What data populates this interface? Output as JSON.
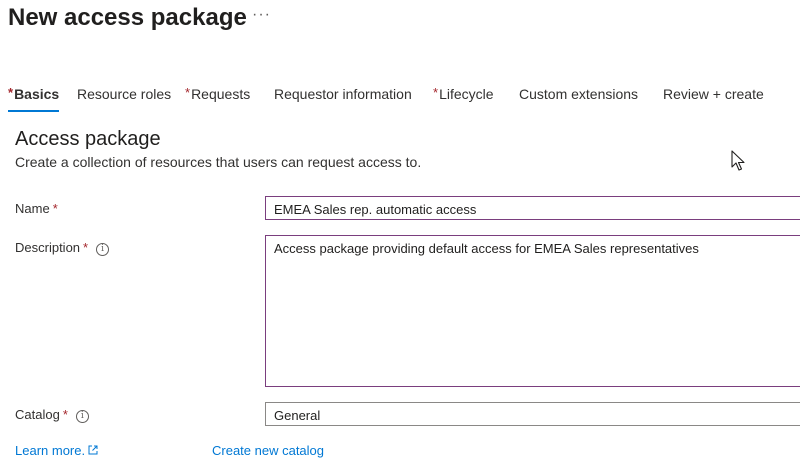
{
  "header": {
    "title": "New access package",
    "more_label": "···"
  },
  "tabs": [
    {
      "label": "Basics",
      "required": true,
      "active": true
    },
    {
      "label": "Resource roles",
      "required": false
    },
    {
      "label": "Requests",
      "required": true
    },
    {
      "label": "Requestor information",
      "required": false
    },
    {
      "label": "Lifecycle",
      "required": true
    },
    {
      "label": "Custom extensions",
      "required": false
    },
    {
      "label": "Review + create",
      "required": false
    }
  ],
  "required_marker": "*",
  "section": {
    "title": "Access package",
    "description": "Create a collection of resources that users can request access to."
  },
  "form": {
    "name": {
      "label": "Name",
      "value": "EMEA Sales rep. automatic access"
    },
    "description": {
      "label": "Description",
      "value": "Access package providing default access for EMEA Sales representatives"
    },
    "catalog": {
      "label": "Catalog",
      "value": "General"
    }
  },
  "links": {
    "learn_more": "Learn more.",
    "create_catalog": "Create new catalog"
  },
  "colors": {
    "accent": "#0078d4",
    "required": "#a4262c",
    "focus_border": "#7a3e7e"
  }
}
